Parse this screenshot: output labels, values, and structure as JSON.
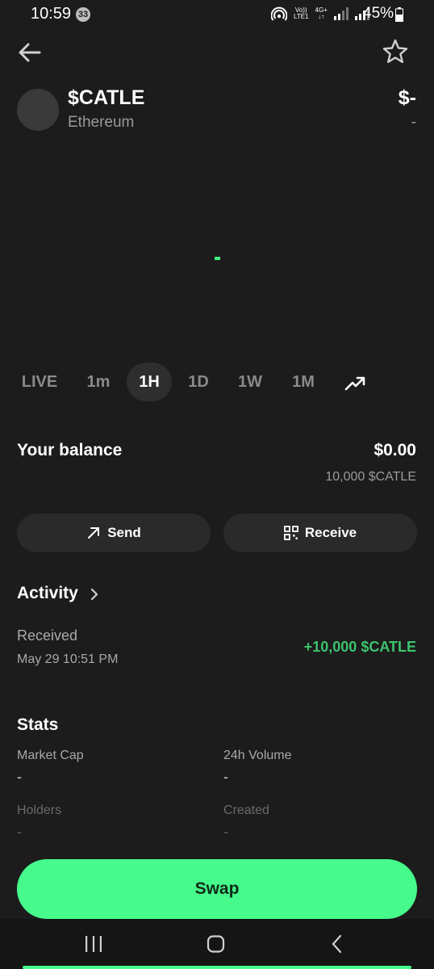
{
  "status_bar": {
    "time": "10:59",
    "notification_count": "33",
    "network_label_top": "Vo))",
    "network_label_bottom": "LTE1",
    "network_type": "4G+",
    "battery": "45%"
  },
  "header": {
    "back_icon": "arrow-left-icon",
    "favorite_icon": "star-outline-icon"
  },
  "token": {
    "name": "$CATLE",
    "chain": "Ethereum",
    "price": "$-",
    "price_change": "-"
  },
  "chart_tabs": [
    {
      "label": "LIVE",
      "active": false
    },
    {
      "label": "1m",
      "active": false
    },
    {
      "label": "1H",
      "active": true
    },
    {
      "label": "1D",
      "active": false
    },
    {
      "label": "1W",
      "active": false
    },
    {
      "label": "1M",
      "active": false
    }
  ],
  "chart_type_icon": "trending-up-icon",
  "colors": {
    "background": "#1c1c1c",
    "accent": "#46fb8c",
    "positive": "#3cc36e",
    "muted_text": "#9a9a9a"
  },
  "balance": {
    "label": "Your balance",
    "value": "$0.00",
    "amount": "10,000 $CATLE"
  },
  "actions": {
    "send_label": "Send",
    "receive_label": "Receive",
    "send_icon": "arrow-up-right-icon",
    "receive_icon": "qr-code-icon"
  },
  "activity": {
    "title": "Activity",
    "items": [
      {
        "type": "Received",
        "date": "May 29 10:51 PM",
        "amount": "+10,000 $CATLE"
      }
    ]
  },
  "stats": {
    "title": "Stats",
    "items": [
      {
        "label": "Market Cap",
        "value": "-"
      },
      {
        "label": "24h Volume",
        "value": "-"
      },
      {
        "label": "Holders",
        "value": "-"
      },
      {
        "label": "Created",
        "value": "-"
      }
    ]
  },
  "swap_label": "Swap",
  "system_nav": {
    "recents_icon": "recents-icon",
    "home_icon": "home-icon",
    "back_icon": "nav-back-icon"
  }
}
